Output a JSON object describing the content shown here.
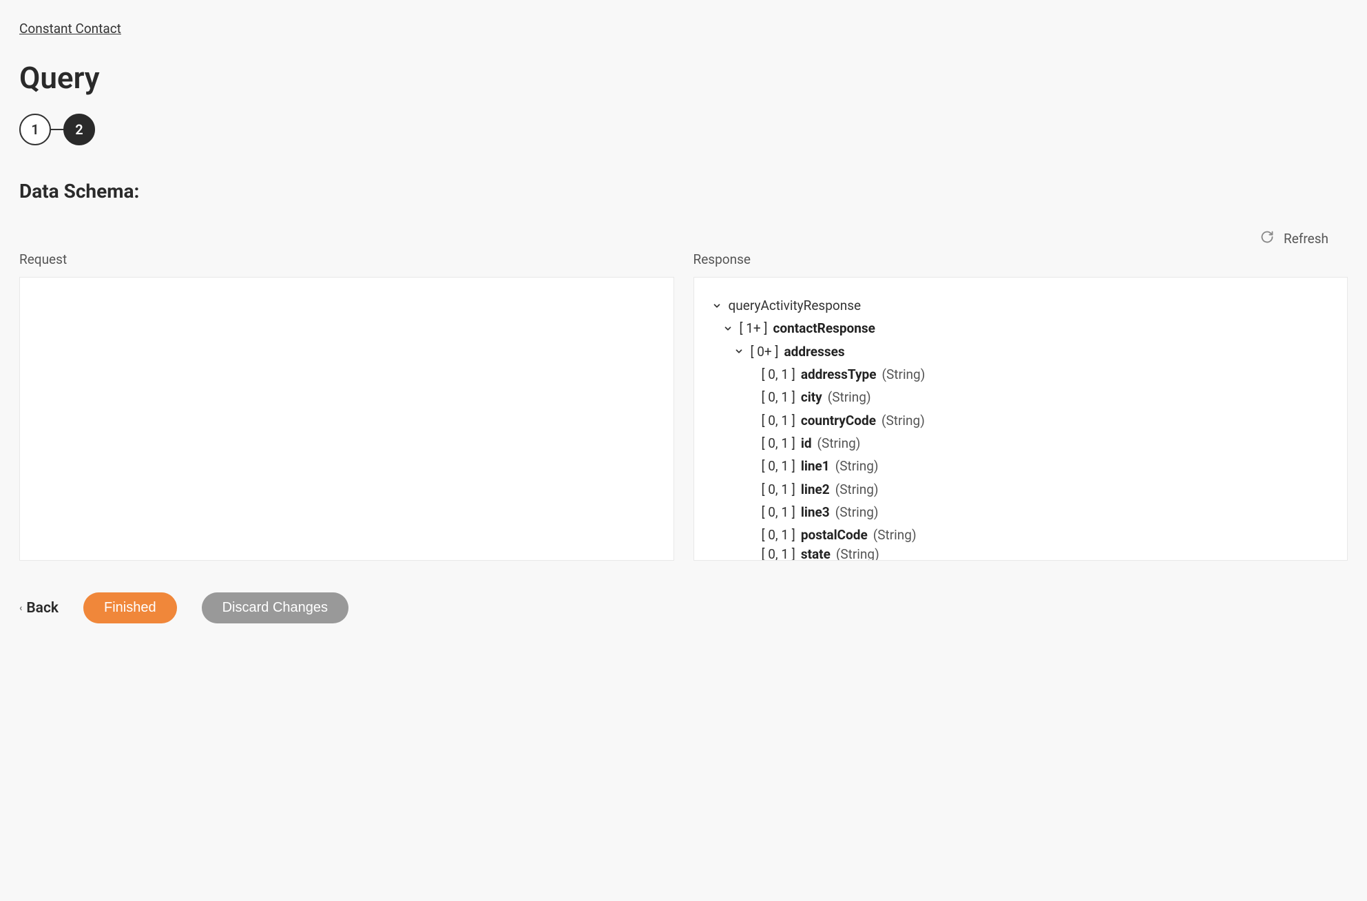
{
  "breadcrumb": "Constant Contact",
  "title": "Query",
  "stepper": {
    "step1": "1",
    "step2": "2"
  },
  "section_title": "Data Schema:",
  "refresh_label": "Refresh",
  "panels": {
    "request_label": "Request",
    "response_label": "Response"
  },
  "tree": {
    "root": {
      "label": "queryActivityResponse"
    },
    "contactResponse": {
      "card": "[ 1+ ]",
      "name": "contactResponse"
    },
    "addresses": {
      "card": "[ 0+ ]",
      "name": "addresses"
    },
    "fields": [
      {
        "card": "[ 0, 1 ]",
        "name": "addressType",
        "type": "(String)"
      },
      {
        "card": "[ 0, 1 ]",
        "name": "city",
        "type": "(String)"
      },
      {
        "card": "[ 0, 1 ]",
        "name": "countryCode",
        "type": "(String)"
      },
      {
        "card": "[ 0, 1 ]",
        "name": "id",
        "type": "(String)"
      },
      {
        "card": "[ 0, 1 ]",
        "name": "line1",
        "type": "(String)"
      },
      {
        "card": "[ 0, 1 ]",
        "name": "line2",
        "type": "(String)"
      },
      {
        "card": "[ 0, 1 ]",
        "name": "line3",
        "type": "(String)"
      },
      {
        "card": "[ 0, 1 ]",
        "name": "postalCode",
        "type": "(String)"
      },
      {
        "card": "[ 0, 1 ]",
        "name": "state",
        "type": "(String)"
      }
    ]
  },
  "footer": {
    "back": "Back",
    "finished": "Finished",
    "discard": "Discard Changes"
  }
}
